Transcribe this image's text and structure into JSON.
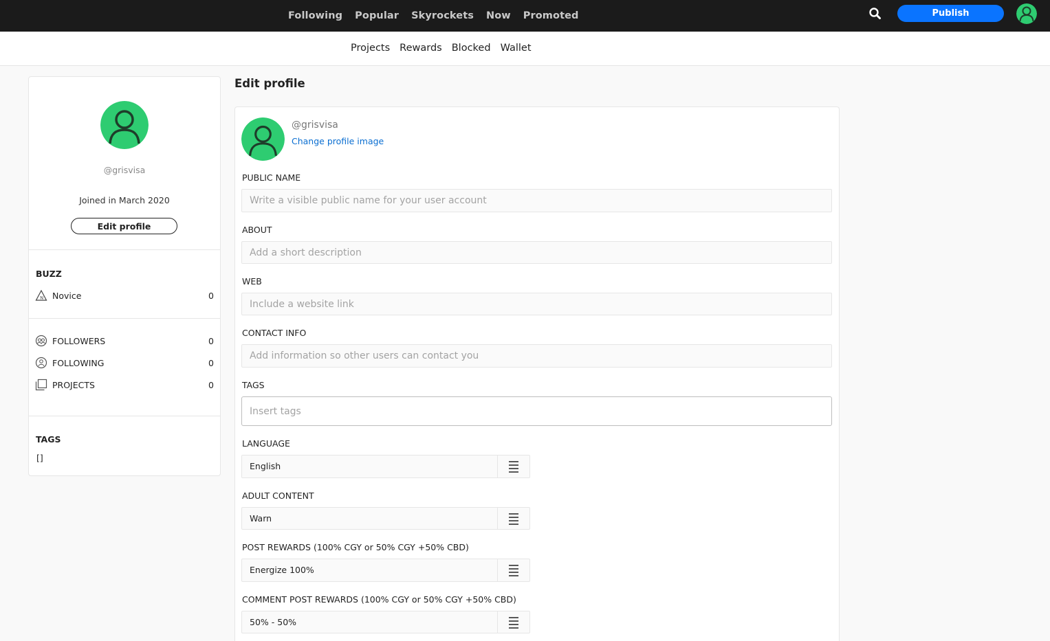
{
  "topnav": {
    "items": [
      "Following",
      "Popular",
      "Skyrockets",
      "Now",
      "Promoted"
    ],
    "publish_label": "Publish"
  },
  "subnav": {
    "items": [
      "Projects",
      "Rewards",
      "Blocked",
      "Wallet"
    ]
  },
  "profile": {
    "handle": "@grisvisa",
    "joined": "Joined in March 2020",
    "edit_label": "Edit profile",
    "buzz_title": "BUZZ",
    "buzz_level": "Novice",
    "buzz_value": "0",
    "followers_label": "FOLLOWERS",
    "followers_value": "0",
    "following_label": "FOLLOWING",
    "following_value": "0",
    "projects_label": "PROJECTS",
    "projects_value": "0",
    "tags_title": "TAGS",
    "tags_value": "[]"
  },
  "edit": {
    "title": "Edit profile",
    "handle": "@grisvisa",
    "change_image": "Change profile image",
    "public_name_label": "PUBLIC NAME",
    "public_name_placeholder": "Write a visible public name for your user account",
    "about_label": "ABOUT",
    "about_placeholder": "Add a short description",
    "web_label": "WEB",
    "web_placeholder": "Include a website link",
    "contact_label": "CONTACT INFO",
    "contact_placeholder": "Add information so other users can contact you",
    "tags_label": "TAGS",
    "tags_placeholder": "Insert tags",
    "language_label": "LANGUAGE",
    "language_value": "English",
    "adult_label": "ADULT CONTENT",
    "adult_value": "Warn",
    "post_rewards_label": "POST REWARDS (100% CGY or 50% CGY +50% CBD)",
    "post_rewards_value": "Energize 100%",
    "comment_rewards_label": "COMMENT POST REWARDS (100% CGY or 50% CGY +50% CBD)",
    "comment_rewards_value": "50% - 50%"
  },
  "colors": {
    "accent": "#0a74ff",
    "avatar_green": "#2ecc71",
    "topbar": "#1b1b1b"
  }
}
